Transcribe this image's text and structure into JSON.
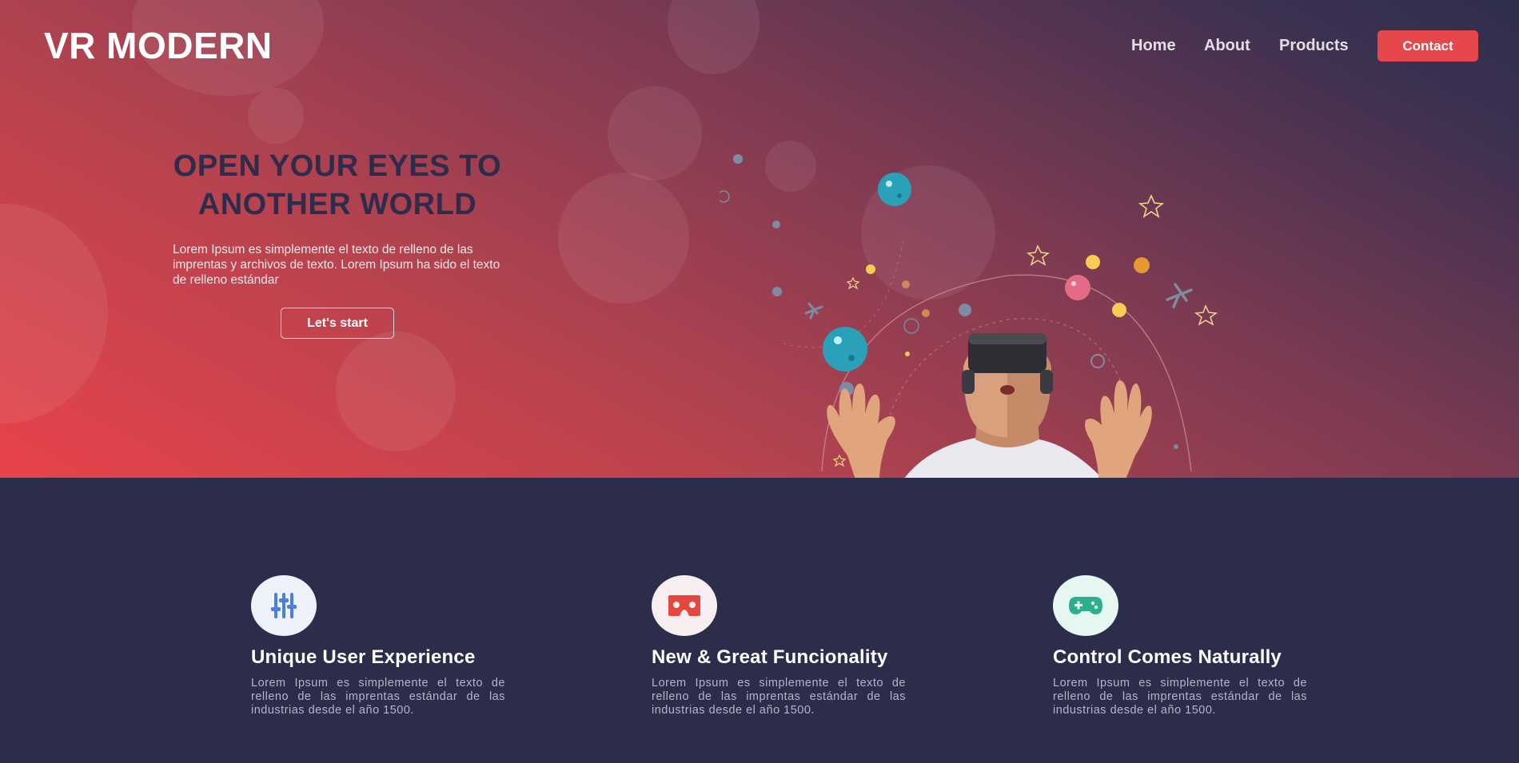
{
  "brand": {
    "logo": "VR MODERN"
  },
  "nav": {
    "items": [
      {
        "label": "Home"
      },
      {
        "label": "About"
      },
      {
        "label": "Products"
      }
    ],
    "contact_label": "Contact"
  },
  "hero": {
    "title_line1": "OPEN YOUR EYES TO",
    "title_line2": "ANOTHER WORLD",
    "description": "Lorem Ipsum es simplemente el texto de relleno de las imprentas y archivos de texto. Lorem Ipsum ha sido el texto de relleno estándar",
    "cta_label": "Let's start",
    "illustration": "vr-headset-person-in-space"
  },
  "features": [
    {
      "icon": "sliders-icon",
      "icon_color": "#4a7fe0",
      "icon_bg": "#eef3fb",
      "title": "Unique User Experience",
      "text": "Lorem Ipsum es simplemente el texto de relleno de las imprentas estándar de las industrias desde el año 1500."
    },
    {
      "icon": "vr-glasses-icon",
      "icon_color": "#e3473f",
      "icon_bg": "#f8eef0",
      "title": "New & Great Funcionality",
      "text": "Lorem Ipsum es simplemente el texto de relleno de las imprentas estándar de las industrias desde el año 1500."
    },
    {
      "icon": "gamepad-icon",
      "icon_color": "#2fae8e",
      "icon_bg": "#e6f6f1",
      "title": "Control Comes Naturally",
      "text": "Lorem Ipsum es simplemente el texto de relleno de las imprentas estándar de las industrias desde el año 1500."
    }
  ],
  "colors": {
    "accent": "#e5474a",
    "dark_bg": "#2b2d4b",
    "title_dark": "#2e2c4a"
  }
}
